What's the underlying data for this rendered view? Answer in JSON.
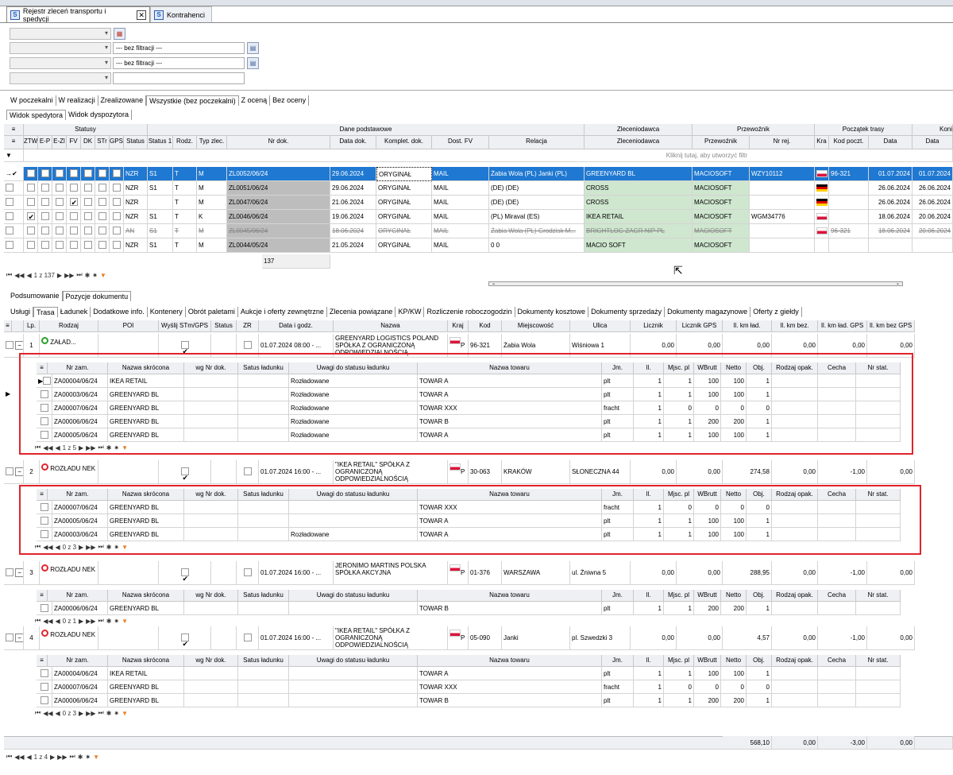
{
  "tabs": [
    {
      "label": "Rejestr zleceń transportu i spedycji"
    },
    {
      "label": "Kontrahenci"
    }
  ],
  "filters": {
    "none1": "--- bez filtracji ---",
    "none2": "--- bez filtracji ---"
  },
  "status_tabs": [
    "W poczekalni",
    "W realizacji",
    "Zrealizowane",
    "Wszystkie (bez poczekalni)",
    "Z oceną",
    "Bez oceny"
  ],
  "view_tabs": [
    "Widok spedytora",
    "Widok dyspozytora"
  ],
  "groups": {
    "statusy": "Statusy",
    "dane": "Dane podstawowe",
    "zlec": "Zleceniodawca",
    "przew": "Przewoźnik",
    "poczatek": "Początek trasy",
    "koniec": "Koni"
  },
  "cols": {
    "ztw": "ZTW",
    "ep": "E-P",
    "ezl": "E-Zl",
    "fv": "FV",
    "dk": "DK",
    "str": "STr",
    "gps": "GPS",
    "status": "Status",
    "status1": "Status 1",
    "rodz": "Rodz.",
    "typ": "Typ zlec.",
    "nr": "Nr dok.",
    "data": "Data dok.",
    "komplet": "Komplet. dok.",
    "dost": "Dost. FV",
    "relacja": "Relacja",
    "zlec": "Zleceniodawca",
    "przew": "Przewoźnik",
    "nrrej": "Nr rej.",
    "kra": "Kra",
    "kod": "Kod poczt.",
    "data2": "Data",
    "data3": "Data"
  },
  "filter_hint": "Kliknij tutaj, aby utworzyć filtr",
  "orders": [
    {
      "ck": [
        0,
        0,
        0,
        0,
        0,
        0,
        0
      ],
      "status": "NZR",
      "s1": "S1",
      "rodz": "T",
      "typ": "M",
      "nr": "ZL0052/06/24",
      "data": "29.06.2024",
      "komplet": "ORYGINAŁ",
      "dost": "MAIL",
      "relacja": "Żabia Wola (PL) Janki (PL)",
      "zlec": "GREENYARD BL",
      "przew": "MACIOSOFT",
      "nrrej": "WZY10112",
      "flag": "pl",
      "kod": "96-321",
      "d1": "01.07.2024",
      "d2": "01.07.2024"
    },
    {
      "ck": [
        0,
        0,
        0,
        0,
        0,
        0,
        0
      ],
      "status": "NZR",
      "s1": "S1",
      "rodz": "T",
      "typ": "M",
      "nr": "ZL0051/06/24",
      "data": "29.06.2024",
      "komplet": "ORYGINAŁ",
      "dost": "MAIL",
      "relacja": "(DE) (DE)",
      "zlec": "CROSS",
      "przew": "MACIOSOFT",
      "nrrej": "",
      "flag": "de",
      "kod": "",
      "d1": "26.06.2024",
      "d2": "26.06.2024"
    },
    {
      "ck": [
        0,
        0,
        0,
        1,
        0,
        0,
        0
      ],
      "status": "NZR",
      "s1": "",
      "rodz": "T",
      "typ": "M",
      "nr": "ZL0047/06/24",
      "data": "21.06.2024",
      "komplet": "ORYGINAŁ",
      "dost": "MAIL",
      "relacja": "(DE) (DE)",
      "zlec": "CROSS",
      "przew": "MACIOSOFT",
      "nrrej": "",
      "flag": "de",
      "kod": "",
      "d1": "26.06.2024",
      "d2": "26.06.2024"
    },
    {
      "ck": [
        1,
        0,
        0,
        0,
        0,
        0,
        0
      ],
      "status": "NZR",
      "s1": "S1",
      "rodz": "T",
      "typ": "K",
      "nr": "ZL0046/06/24",
      "data": "19.06.2024",
      "komplet": "ORYGINAŁ",
      "dost": "MAIL",
      "relacja": "(PL) Miraval (ES)",
      "zlec": "IKEA RETAIL",
      "przew": "MACIOSOFT",
      "nrrej": "WGM34776",
      "flag": "pl",
      "kod": "",
      "d1": "18.06.2024",
      "d2": "20.06.2024"
    },
    {
      "ck": [
        0,
        0,
        0,
        0,
        0,
        0,
        0
      ],
      "status": "AN",
      "s1": "S1",
      "rodz": "T",
      "typ": "M",
      "nr": "ZL0045/06/24",
      "data": "18.06.2024",
      "komplet": "ORYGINAŁ",
      "dost": "MAIL",
      "relacja": "Żabia Wola (PL) Grodzisk M...",
      "zlec": "BRIGHTLOG ZAGR NIP PL",
      "przew": "MACIOSOFT",
      "nrrej": "",
      "flag": "pl",
      "kod": "96-321",
      "d1": "18.06.2024",
      "d2": "20.06.2024"
    },
    {
      "ck": [
        0,
        0,
        0,
        0,
        0,
        0,
        0
      ],
      "status": "NZR",
      "s1": "S1",
      "rodz": "T",
      "typ": "M",
      "nr": "ZL0044/05/24",
      "data": "21.05.2024",
      "komplet": "ORYGINAŁ",
      "dost": "MAIL",
      "relacja": "0 0",
      "zlec": "MACIO SOFT",
      "przew": "MACIOSOFT",
      "nrrej": "",
      "flag": "",
      "kod": "",
      "d1": "",
      "d2": ""
    }
  ],
  "count": "137",
  "nav_top": "1 z 137",
  "lower_tabs": [
    "Podsumowanie",
    "Pozycje dokumentu"
  ],
  "doc_tabs": [
    "Usługi",
    "Trasa",
    "Ładunek",
    "Dodatkowe info.",
    "Kontenery",
    "Obrót paletami",
    "Aukcje i oferty zewnętrzne",
    "Zlecenia powiązane",
    "KP/KW",
    "Rozliczenie roboczogodzin",
    "Dokumenty kosztowe",
    "Dokumenty sprzedaży",
    "Dokumenty magazynowe",
    "Oferty z giełdy"
  ],
  "route_cols": {
    "lp": "Lp.",
    "rodzaj": "Rodzaj",
    "poi": "POI",
    "wysl": "Wyślij STm/GPS",
    "status": "Status",
    "zr": "ZR",
    "data": "Data i godz.",
    "nazwa": "Nazwa",
    "kraj": "Kraj",
    "kod": "Kod",
    "miej": "Miejscowość",
    "ulica": "Ulica",
    "licznik": "Licznik",
    "lgps": "Licznik GPS",
    "ilkm": "Il. km ład.",
    "ilkmbez": "Il. km bez.",
    "ilkmgps": "Il. km ład. GPS",
    "ilkmbezgps": "Il. km bez GPS"
  },
  "sub_cols": {
    "nr": "Nr zam.",
    "nazwa": "Nazwa skrócona",
    "wg": "wg Nr dok.",
    "satus": "Satus ładunku",
    "uwagi": "Uwagi do statusu ładunku",
    "towar": "Nazwa towaru",
    "jm": "Jm.",
    "il": "Il.",
    "mjsc": "Mjsc. pl",
    "wbrut": "WBrutt",
    "netto": "Netto",
    "obj": "Obj.",
    "opak": "Rodzaj opak.",
    "cecha": "Cecha",
    "nrstat": "Nr stat."
  },
  "stops": [
    {
      "lp": "1",
      "rodzaj": "ZAŁAD...",
      "pin": "g",
      "data": "01.07.2024 08:00 - ...",
      "nazwa": "GREENYARD LOGISTICS POLAND SPÓŁKA Z OGRANICZONĄ ODPOWIEDZIALNOŚCIĄ",
      "kraj": "P",
      "kod": "96-321",
      "miej": "Żabia Wola",
      "ulica": "Wiśniowa 1",
      "licznik": "0,00",
      "lgps": "0,00",
      "ilkm": "0,00",
      "ilkmbez": "0,00",
      "ilkmgps": "0,00",
      "ilkmbezgps": "0,00",
      "nav": "1 z 5",
      "items": [
        {
          "nr": "ZA00004/06/24",
          "nazwa": "IKEA RETAIL",
          "uwagi": "Rozładowane",
          "towar": "TOWAR A",
          "jm": "plt",
          "il": "1",
          "mjsc": "1",
          "wbrut": "100",
          "netto": "100",
          "obj": "1"
        },
        {
          "nr": "ZA00003/06/24",
          "nazwa": "GREENYARD BL",
          "uwagi": "Rozładowane",
          "towar": "TOWAR A",
          "jm": "plt",
          "il": "1",
          "mjsc": "1",
          "wbrut": "100",
          "netto": "100",
          "obj": "1"
        },
        {
          "nr": "ZA00007/06/24",
          "nazwa": "GREENYARD BL",
          "uwagi": "Rozładowane",
          "towar": "TOWAR XXX",
          "jm": "fracht",
          "il": "1",
          "mjsc": "0",
          "wbrut": "0",
          "netto": "0",
          "obj": "0"
        },
        {
          "nr": "ZA00006/06/24",
          "nazwa": "GREENYARD BL",
          "uwagi": "Rozładowane",
          "towar": "TOWAR B",
          "jm": "plt",
          "il": "1",
          "mjsc": "1",
          "wbrut": "200",
          "netto": "200",
          "obj": "1"
        },
        {
          "nr": "ZA00005/06/24",
          "nazwa": "GREENYARD BL",
          "uwagi": "Rozładowane",
          "towar": "TOWAR A",
          "jm": "plt",
          "il": "1",
          "mjsc": "1",
          "wbrut": "100",
          "netto": "100",
          "obj": "1"
        }
      ]
    },
    {
      "lp": "2",
      "rodzaj": "ROZŁADU NEK",
      "pin": "r",
      "data": "01.07.2024 16:00 - ...",
      "nazwa": "\"IKEA RETAIL\" SPÓŁKA Z OGRANICZONĄ ODPOWIEDZIALNOŚCIĄ",
      "kraj": "P",
      "kod": "30-063",
      "miej": "KRAKÓW",
      "ulica": "SŁONECZNA 44",
      "licznik": "0,00",
      "lgps": "0,00",
      "ilkm": "274,58",
      "ilkmbez": "0,00",
      "ilkmgps": "-1,00",
      "ilkmbezgps": "0,00",
      "nav": "0 z 3",
      "items": [
        {
          "nr": "ZA00007/06/24",
          "nazwa": "GREENYARD BL",
          "uwagi": "",
          "towar": "TOWAR XXX",
          "jm": "fracht",
          "il": "1",
          "mjsc": "0",
          "wbrut": "0",
          "netto": "0",
          "obj": "0"
        },
        {
          "nr": "ZA00005/06/24",
          "nazwa": "GREENYARD BL",
          "uwagi": "",
          "towar": "TOWAR A",
          "jm": "plt",
          "il": "1",
          "mjsc": "1",
          "wbrut": "100",
          "netto": "100",
          "obj": "1"
        },
        {
          "nr": "ZA00003/06/24",
          "nazwa": "GREENYARD BL",
          "uwagi": "Rozładowane",
          "towar": "TOWAR A",
          "jm": "plt",
          "il": "1",
          "mjsc": "1",
          "wbrut": "100",
          "netto": "100",
          "obj": "1"
        }
      ]
    },
    {
      "lp": "3",
      "rodzaj": "ROZŁADU NEK",
      "pin": "r",
      "data": "01.07.2024 16:00 - ...",
      "nazwa": "JERONIMO MARTINS POLSKA SPÓŁKA AKCYJNA",
      "kraj": "P",
      "kod": "01-376",
      "miej": "WARSZAWA",
      "ulica": "ul. Żniwna 5",
      "licznik": "0,00",
      "lgps": "0,00",
      "ilkm": "288,95",
      "ilkmbez": "0,00",
      "ilkmgps": "-1,00",
      "ilkmbezgps": "0,00",
      "nav": "0 z 1",
      "items": [
        {
          "nr": "ZA00006/06/24",
          "nazwa": "GREENYARD BL",
          "uwagi": "",
          "towar": "TOWAR B",
          "jm": "plt",
          "il": "1",
          "mjsc": "1",
          "wbrut": "200",
          "netto": "200",
          "obj": "1"
        }
      ]
    },
    {
      "lp": "4",
      "rodzaj": "ROZŁADU NEK",
      "pin": "r",
      "data": "01.07.2024 16:00 - ...",
      "nazwa": "\"IKEA RETAIL\" SPÓŁKA Z OGRANICZONĄ ODPOWIEDZIALNOŚCIĄ",
      "kraj": "P",
      "kod": "05-090",
      "miej": "Janki",
      "ulica": "pl. Szwedzki 3",
      "licznik": "0,00",
      "lgps": "0,00",
      "ilkm": "4,57",
      "ilkmbez": "0,00",
      "ilkmgps": "-1,00",
      "ilkmbezgps": "0,00",
      "nav": "0 z 3",
      "items": [
        {
          "nr": "ZA00004/06/24",
          "nazwa": "IKEA RETAIL",
          "uwagi": "",
          "towar": "TOWAR A",
          "jm": "plt",
          "il": "1",
          "mjsc": "1",
          "wbrut": "100",
          "netto": "100",
          "obj": "1"
        },
        {
          "nr": "ZA00007/06/24",
          "nazwa": "GREENYARD BL",
          "uwagi": "",
          "towar": "TOWAR XXX",
          "jm": "fracht",
          "il": "1",
          "mjsc": "0",
          "wbrut": "0",
          "netto": "0",
          "obj": "0"
        },
        {
          "nr": "ZA00006/06/24",
          "nazwa": "GREENYARD BL",
          "uwagi": "",
          "towar": "TOWAR B",
          "jm": "plt",
          "il": "1",
          "mjsc": "1",
          "wbrut": "200",
          "netto": "200",
          "obj": "1"
        }
      ]
    }
  ],
  "totals": {
    "ilkm": "568,10",
    "ilkmbez": "0,00",
    "ilkmgps": "-3,00",
    "ilkmbezgps": "0,00"
  },
  "nav_bottom": "1 z 4",
  "colors": {
    "selection": "#1f78d1",
    "highlight_box": "#e0242c",
    "carrier_bg": "#cfe6cf",
    "nr_bg": "#bdbdbd"
  }
}
